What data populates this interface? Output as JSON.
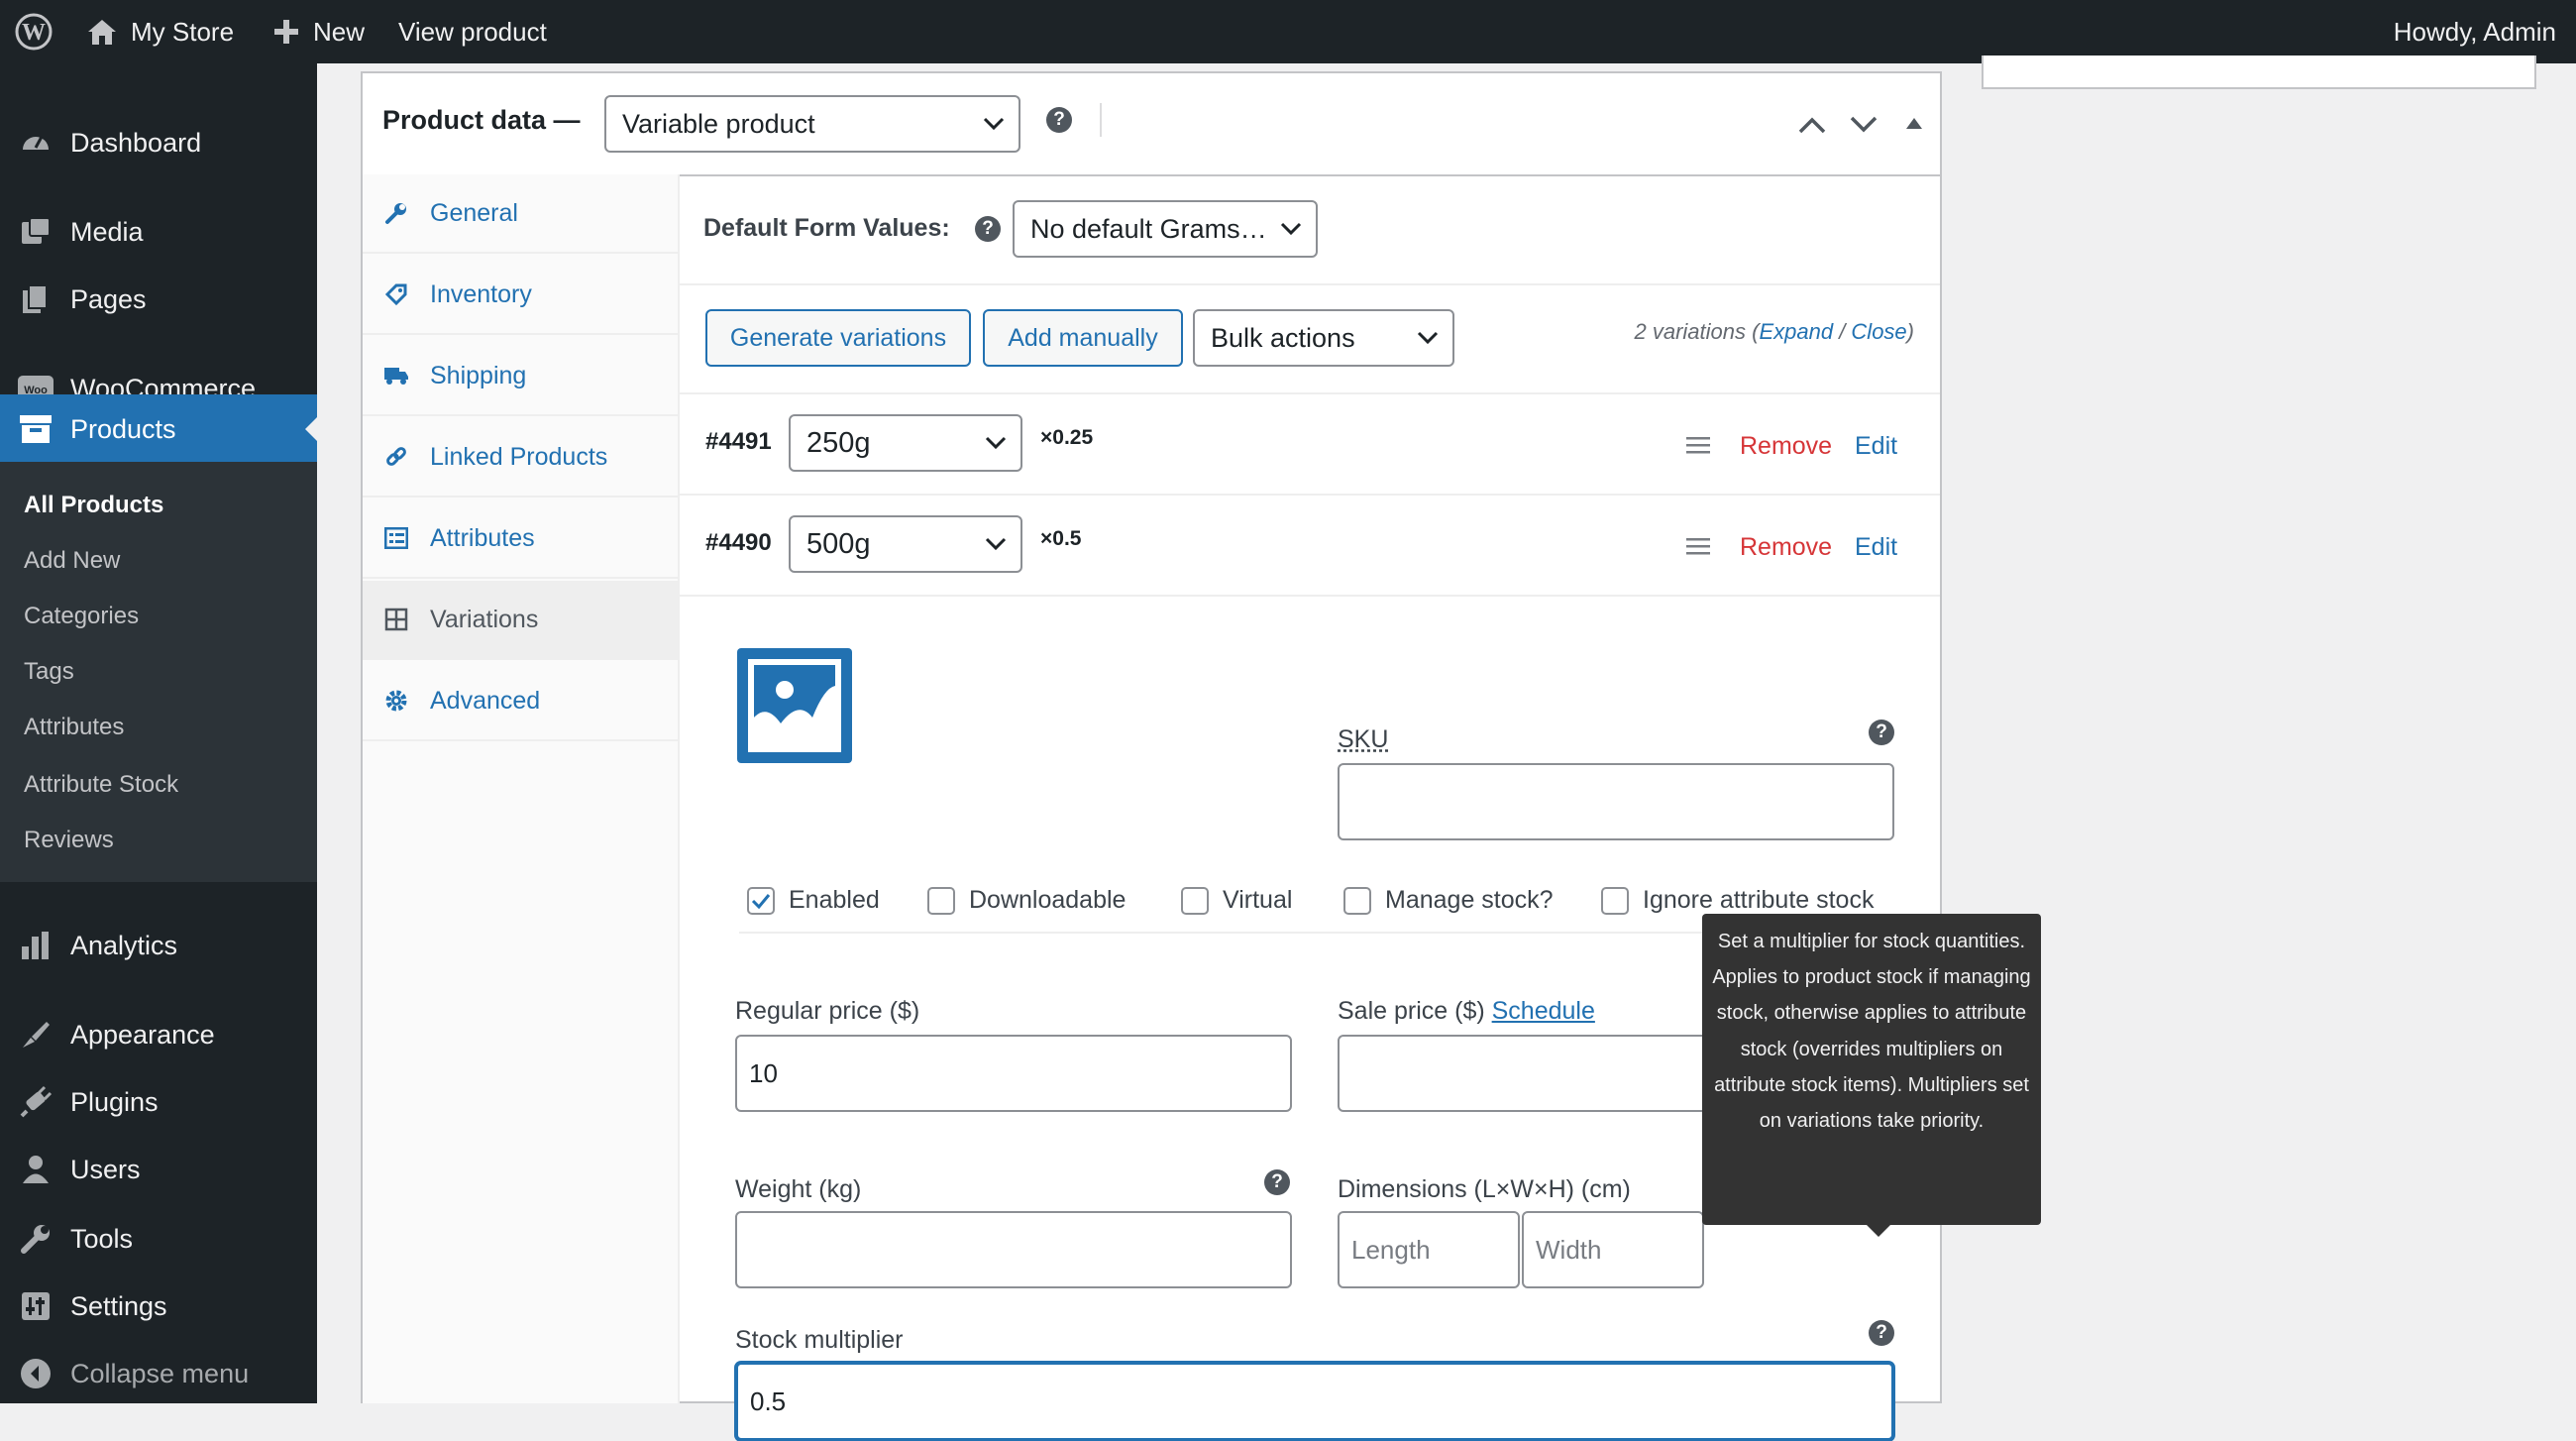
{
  "adminbar": {
    "site_name": "My Store",
    "new_label": "New",
    "view_product": "View product",
    "greeting": "Howdy, Admin"
  },
  "sidebar": {
    "items": [
      {
        "label": "Dashboard",
        "icon": "dashboard-icon"
      },
      {
        "label": "Media",
        "icon": "media-icon"
      },
      {
        "label": "Pages",
        "icon": "pages-icon"
      },
      {
        "label": "WooCommerce",
        "icon": "woocommerce-icon"
      },
      {
        "label": "Products",
        "icon": "products-icon"
      },
      {
        "label": "Analytics",
        "icon": "analytics-icon"
      },
      {
        "label": "Appearance",
        "icon": "appearance-icon"
      },
      {
        "label": "Plugins",
        "icon": "plugins-icon"
      },
      {
        "label": "Users",
        "icon": "users-icon"
      },
      {
        "label": "Tools",
        "icon": "tools-icon"
      },
      {
        "label": "Settings",
        "icon": "settings-icon"
      },
      {
        "label": "Collapse menu",
        "icon": "collapse-icon"
      }
    ],
    "submenu": [
      "All Products",
      "Add New",
      "Categories",
      "Tags",
      "Attributes",
      "Attribute Stock",
      "Reviews"
    ]
  },
  "product_data": {
    "title": "Product data —",
    "type_select": "Variable product",
    "tabs": [
      {
        "label": "General",
        "icon": "wrench-icon"
      },
      {
        "label": "Inventory",
        "icon": "tag-icon"
      },
      {
        "label": "Shipping",
        "icon": "truck-icon"
      },
      {
        "label": "Linked Products",
        "icon": "link-icon"
      },
      {
        "label": "Attributes",
        "icon": "list-icon"
      },
      {
        "label": "Variations",
        "icon": "grid-icon"
      },
      {
        "label": "Advanced",
        "icon": "gear-icon"
      }
    ],
    "default_form_values_label": "Default Form Values:",
    "default_form_values_select": "No default Grams…",
    "generate_variations": "Generate variations",
    "add_manually": "Add manually",
    "bulk_actions": "Bulk actions",
    "variations_count": "2 variations (",
    "expand": "Expand",
    "slash": " / ",
    "close": "Close",
    "close_paren": ")",
    "variations": [
      {
        "id": "#4491",
        "option": "250g",
        "multiplier": "×0.25",
        "remove": "Remove",
        "edit": "Edit"
      },
      {
        "id": "#4490",
        "option": "500g",
        "multiplier": "×0.5",
        "remove": "Remove",
        "edit": "Edit"
      }
    ],
    "form": {
      "sku_label": "SKU",
      "sku_value": "",
      "checkboxes": [
        {
          "label": "Enabled",
          "checked": true
        },
        {
          "label": "Downloadable",
          "checked": false
        },
        {
          "label": "Virtual",
          "checked": false
        },
        {
          "label": "Manage stock?",
          "checked": false
        },
        {
          "label": "Ignore attribute stock",
          "checked": false
        }
      ],
      "regular_price_label": "Regular price ($)",
      "regular_price_value": "10",
      "sale_price_label": "Sale price ($)",
      "schedule_link": "Schedule",
      "sale_price_value": "",
      "weight_label": "Weight (kg)",
      "weight_value": "",
      "dimensions_label": "Dimensions (L×W×H) (cm)",
      "length_placeholder": "Length",
      "width_placeholder": "Width",
      "stock_multiplier_label": "Stock multiplier",
      "stock_multiplier_value": "0.5"
    },
    "tooltip": "Set a multiplier for stock quantities. Applies to product stock if managing stock, otherwise applies to attribute stock (overrides multipliers on attribute stock items). Multipliers set on variations take priority."
  },
  "colors": {
    "accent": "#2271b1",
    "admin_dark": "#1d2327",
    "remove_red": "#d63638"
  }
}
